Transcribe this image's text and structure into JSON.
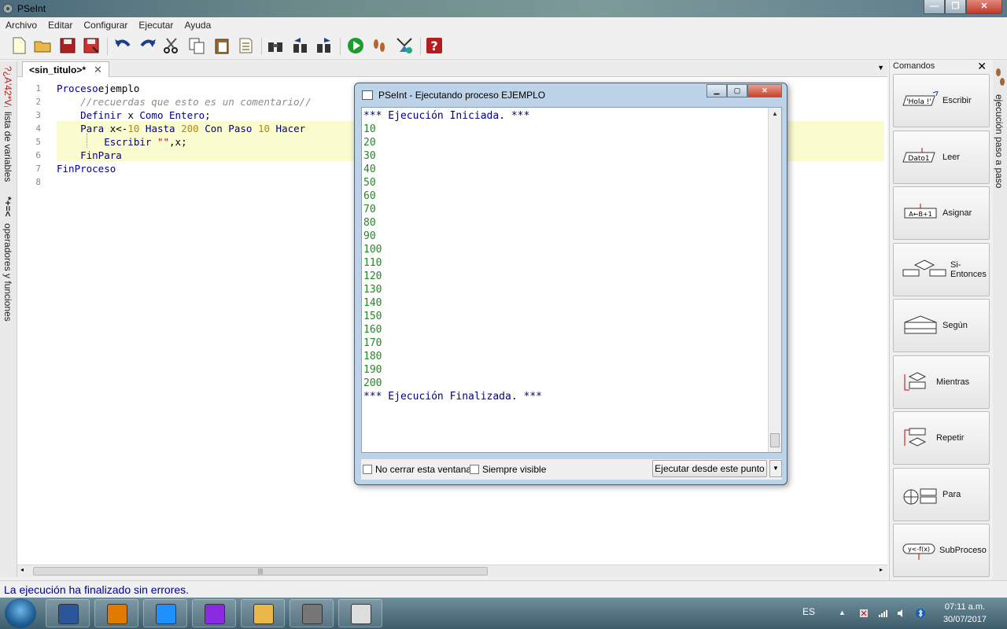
{
  "window": {
    "title": "PSeInt"
  },
  "menu": [
    "Archivo",
    "Editar",
    "Configurar",
    "Ejecutar",
    "Ayuda"
  ],
  "toolbar_icons": [
    "new-file-icon",
    "open-file-icon",
    "save-icon",
    "save-as-icon",
    "undo-icon",
    "redo-icon",
    "cut-icon",
    "copy-icon",
    "paste-icon",
    "indent-icon",
    "find-icon",
    "find-prev-icon",
    "find-next-icon",
    "run-icon",
    "step-run-icon",
    "debug-icon",
    "help-icon"
  ],
  "left_panel": {
    "variables_label": "lista de variables",
    "variables_glyphs": "?¿A'42*Vᵢ",
    "operators_label": "operadores y funciones",
    "operators_glyphs": "*+=<"
  },
  "editor": {
    "tab_label": "<sin_titulo>*",
    "lines": [
      {
        "n": "1",
        "segments": [
          [
            "kw",
            "Proceso"
          ],
          [
            "",
            "ejemplo"
          ]
        ]
      },
      {
        "n": "2",
        "segments": [
          [
            "cm",
            "    //recuerdas que esto es un comentario//"
          ]
        ]
      },
      {
        "n": "3",
        "segments": [
          [
            "kw",
            "    Definir"
          ],
          [
            "",
            " x "
          ],
          [
            "kw",
            "Como Entero"
          ],
          [
            "",
            ";"
          ]
        ]
      },
      {
        "n": "4",
        "segments": [
          [
            "kw",
            "    Para"
          ],
          [
            "",
            " x<-"
          ],
          [
            "num",
            "10"
          ],
          [
            "",
            " "
          ],
          [
            "kw",
            "Hasta"
          ],
          [
            "",
            " "
          ],
          [
            "num",
            "200"
          ],
          [
            "",
            " "
          ],
          [
            "kw",
            "Con Paso"
          ],
          [
            "",
            " "
          ],
          [
            "num",
            "10"
          ],
          [
            "",
            " "
          ],
          [
            "kw",
            "Hacer"
          ]
        ]
      },
      {
        "n": "5",
        "segments": [
          [
            "kw",
            "        Escribir"
          ],
          [
            "",
            " "
          ],
          [
            "str",
            "\"\""
          ],
          [
            "",
            ",x;"
          ]
        ]
      },
      {
        "n": "6",
        "segments": [
          [
            "kw",
            "    FinPara"
          ]
        ]
      },
      {
        "n": "7",
        "segments": [
          [
            "kw",
            "FinProceso"
          ]
        ]
      },
      {
        "n": "8",
        "segments": []
      }
    ]
  },
  "commands_panel": {
    "title": "Comandos",
    "items": [
      {
        "label": "Escribir",
        "icon": "write-icon",
        "icon_text": "'Hola !'"
      },
      {
        "label": "Leer",
        "icon": "read-icon",
        "icon_text": "Dato1"
      },
      {
        "label": "Asignar",
        "icon": "assign-icon",
        "icon_text": "A←B+1"
      },
      {
        "label": "Si-Entonces",
        "icon": "if-then-icon",
        "icon_text": ""
      },
      {
        "label": "Según",
        "icon": "switch-icon",
        "icon_text": ""
      },
      {
        "label": "Mientras",
        "icon": "while-icon",
        "icon_text": ""
      },
      {
        "label": "Repetir",
        "icon": "repeat-icon",
        "icon_text": ""
      },
      {
        "label": "Para",
        "icon": "for-icon",
        "icon_text": ""
      },
      {
        "label": "SubProceso",
        "icon": "subprocess-icon",
        "icon_text": "y<-f(x)"
      }
    ]
  },
  "right_strip": {
    "label": "ejecución paso a paso"
  },
  "status": {
    "message": "La ejecución ha finalizado sin errores."
  },
  "run_dialog": {
    "title": "PSeInt - Ejecutando proceso EJEMPLO",
    "start_msg": "*** Ejecución Iniciada. ***",
    "output": [
      "10",
      "20",
      "30",
      "40",
      "50",
      "60",
      "70",
      "80",
      "90",
      "100",
      "110",
      "120",
      "130",
      "140",
      "150",
      "160",
      "170",
      "180",
      "190",
      "200"
    ],
    "end_msg": "*** Ejecución Finalizada. ***",
    "checkbox_keep_open": "No cerrar esta ventana",
    "checkbox_always_visible": "Siempre visible",
    "run_from_here_button": "Ejecutar desde este punto"
  },
  "taskbar": {
    "apps": [
      "word-icon",
      "media-player-icon",
      "internet-explorer-icon",
      "paint-icon",
      "file-explorer-icon",
      "pseint-icon",
      "notepad-icon"
    ],
    "language": "ES",
    "time": "07:11 a.m.",
    "date": "30/07/2017"
  }
}
